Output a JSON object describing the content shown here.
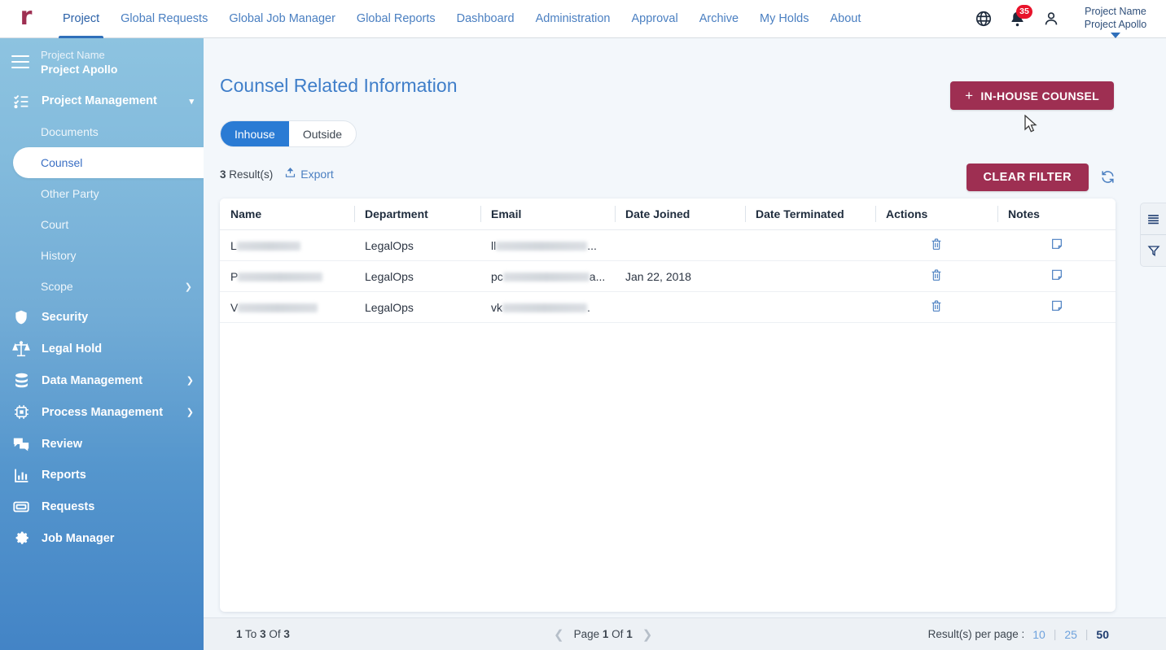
{
  "topnav": {
    "logo": "r",
    "logo_color": "#9e2f52",
    "items": [
      {
        "label": "Project",
        "active": true
      },
      {
        "label": "Global Requests",
        "active": false
      },
      {
        "label": "Global Job Manager",
        "active": false
      },
      {
        "label": "Global Reports",
        "active": false
      },
      {
        "label": "Dashboard",
        "active": false
      },
      {
        "label": "Administration",
        "active": false
      },
      {
        "label": "Approval",
        "active": false
      },
      {
        "label": "Archive",
        "active": false
      },
      {
        "label": "My Holds",
        "active": false
      },
      {
        "label": "About",
        "active": false
      }
    ],
    "globe_icon": "globe-icon",
    "notification_icon": "bell-icon",
    "notification_count": "35",
    "notification_badge_color": "#e8132b",
    "user_icon": "user-icon",
    "project_chip_label": "Project Name",
    "project_chip_value": "Project Apollo"
  },
  "sidebar": {
    "menu_icon": "hamburger-icon",
    "project_label": "Project Name",
    "project_value": "Project Apollo",
    "group": {
      "label": "Project Management",
      "icon": "checklist-icon",
      "chevron": "chevron-down-icon",
      "children": [
        {
          "label": "Documents",
          "active": false,
          "arrow": false
        },
        {
          "label": "Counsel",
          "active": true,
          "arrow": false
        },
        {
          "label": "Other Party",
          "active": false,
          "arrow": false
        },
        {
          "label": "Court",
          "active": false,
          "arrow": false
        },
        {
          "label": "History",
          "active": false,
          "arrow": false
        },
        {
          "label": "Scope",
          "active": false,
          "arrow": true
        }
      ]
    },
    "items": [
      {
        "label": "Security",
        "icon": "shield-icon",
        "arrow": false
      },
      {
        "label": "Legal Hold",
        "icon": "scales-icon",
        "arrow": false
      },
      {
        "label": "Data Management",
        "icon": "database-icon",
        "arrow": true
      },
      {
        "label": "Process Management",
        "icon": "chip-icon",
        "arrow": true
      },
      {
        "label": "Review",
        "icon": "chat-bubbles-icon",
        "arrow": false
      },
      {
        "label": "Reports",
        "icon": "bar-chart-icon",
        "arrow": false
      },
      {
        "label": "Requests",
        "icon": "ticket-icon",
        "arrow": false
      },
      {
        "label": "Job Manager",
        "icon": "gear-icon",
        "arrow": false
      }
    ]
  },
  "main": {
    "title": "Counsel Related Information",
    "add_button": {
      "label": "IN-HOUSE COUNSEL",
      "plus": "+",
      "color": "#9e2f52"
    },
    "tabs": [
      {
        "label": "Inhouse",
        "active": true
      },
      {
        "label": "Outside",
        "active": false
      }
    ],
    "results_count": "3",
    "results_suffix": " Result(s)",
    "export_label": "Export",
    "export_icon": "upload-icon",
    "clear_filter_label": "CLEAR FILTER",
    "refresh_icon": "refresh-icon",
    "accent_blue": "#2a7bd4"
  },
  "table": {
    "columns": [
      "Name",
      "Department",
      "Email",
      "Date Joined",
      "Date Terminated",
      "Actions",
      "Notes"
    ],
    "rows": [
      {
        "name_prefix": "L",
        "name_redacted": true,
        "name_redact_width": 78,
        "department": "LegalOps",
        "email_prefix": "ll",
        "email_redacted": true,
        "email_redact_width": 118,
        "email_suffix": "...",
        "date_joined": "",
        "date_terminated": "",
        "action_icon": "trash-icon",
        "notes_icon": "note-icon"
      },
      {
        "name_prefix": "P",
        "name_redacted": true,
        "name_redact_width": 104,
        "department": "LegalOps",
        "email_prefix": "pc",
        "email_redacted": true,
        "email_redact_width": 113,
        "email_suffix": "a...",
        "date_joined": "Jan 22, 2018",
        "date_terminated": "",
        "action_icon": "trash-icon",
        "notes_icon": "note-icon"
      },
      {
        "name_prefix": "V",
        "name_redacted": true,
        "name_redact_width": 98,
        "department": "LegalOps",
        "email_prefix": "vk",
        "email_redacted": true,
        "email_redact_width": 110,
        "email_suffix": ".",
        "date_joined": "",
        "date_terminated": "",
        "action_icon": "trash-icon",
        "notes_icon": "note-icon"
      }
    ]
  },
  "footer": {
    "range_from": "1",
    "range_to": "3",
    "range_total": "3",
    "range_text_to": "To",
    "range_text_of": "Of",
    "page_word": "Page",
    "page_current": "1",
    "page_of": "Of",
    "page_total": "1",
    "prev_icon": "chevron-left-icon",
    "next_icon": "chevron-right-icon",
    "per_page_label": "Result(s) per page :",
    "per_page_options": [
      {
        "value": "10",
        "selected": false
      },
      {
        "value": "25",
        "selected": false
      },
      {
        "value": "50",
        "selected": true
      }
    ]
  },
  "rail": {
    "buttons": [
      {
        "icon": "columns-list-icon"
      },
      {
        "icon": "filter-funnel-icon"
      }
    ]
  }
}
